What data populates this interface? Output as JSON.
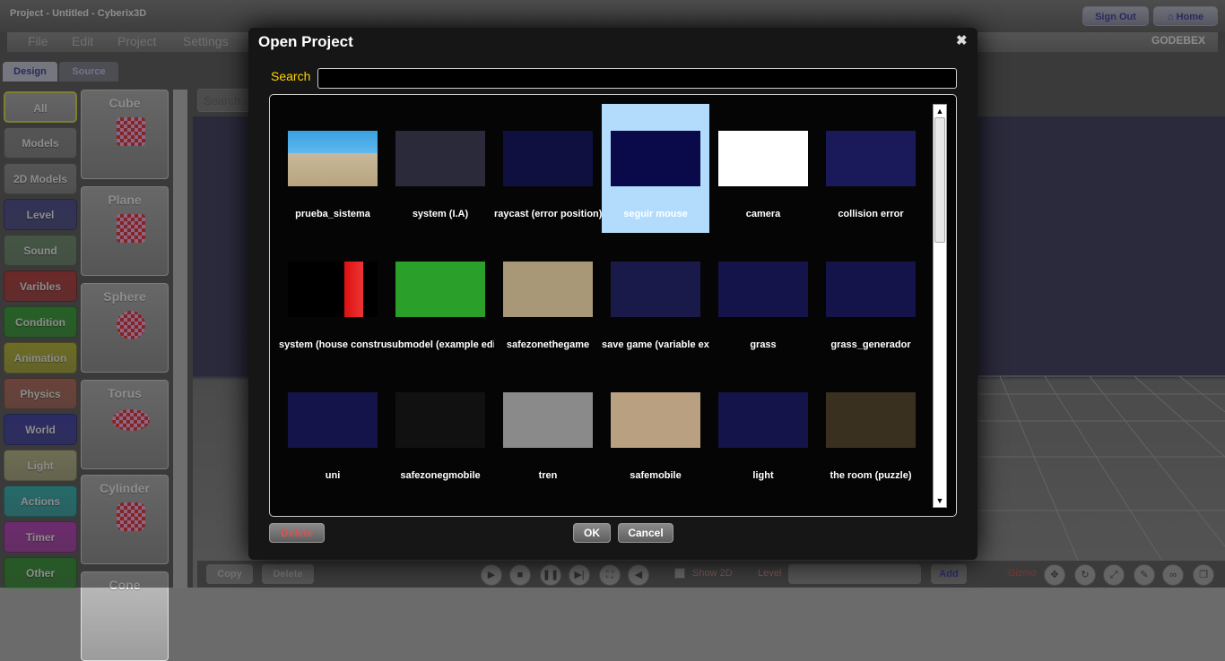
{
  "window": {
    "title": "Project - Untitled - Cyberix3D",
    "signout": "Sign Out",
    "home": "Home"
  },
  "menu": {
    "items": [
      "File",
      "Edit",
      "Project",
      "Settings"
    ],
    "brand": "GODEBEX"
  },
  "tabs": {
    "design": "Design",
    "source": "Source"
  },
  "categories": [
    {
      "label": "All",
      "color": "#b9b9b9"
    },
    {
      "label": "Models",
      "color": "#9c9c9c"
    },
    {
      "label": "2D Models",
      "color": "#9c9c9c"
    },
    {
      "label": "Level",
      "color": "#5b5b9e"
    },
    {
      "label": "Sound",
      "color": "#7f9d7f"
    },
    {
      "label": "Varibles",
      "color": "#c24b4b"
    },
    {
      "label": "Condition",
      "color": "#46b046"
    },
    {
      "label": "Animation",
      "color": "#c6c646"
    },
    {
      "label": "Physics",
      "color": "#c07a6a"
    },
    {
      "label": "World",
      "color": "#5050b8"
    },
    {
      "label": "Light",
      "color": "#c8c89a"
    },
    {
      "label": "Actions",
      "color": "#46c2c2"
    },
    {
      "label": "Timer",
      "color": "#c650c6"
    },
    {
      "label": "Other",
      "color": "#46a446"
    }
  ],
  "objects": [
    "Cube",
    "Plane",
    "Sphere",
    "Torus",
    "Cylinder",
    "Cone"
  ],
  "search": {
    "placeholder": "Search..."
  },
  "bottombar": {
    "copy": "Copy",
    "delete": "Delete",
    "show2d": "Show 2D",
    "level": "Level",
    "add": "Add",
    "gizmo": "Gizmo"
  },
  "dialog": {
    "title": "Open Project",
    "close": "✖",
    "search_label": "Search",
    "projects": [
      {
        "name": "prueba_sistema",
        "selected": false
      },
      {
        "name": "system (I.A)",
        "selected": false
      },
      {
        "name": "raycast (error position)",
        "selected": false
      },
      {
        "name": "seguir mouse",
        "selected": true
      },
      {
        "name": "camera",
        "selected": false
      },
      {
        "name": "collision error",
        "selected": false
      },
      {
        "name": "system (house construction)",
        "selected": false
      },
      {
        "name": "submodel (example editor)",
        "selected": false
      },
      {
        "name": "safezonethegame",
        "selected": false
      },
      {
        "name": "save game (variable example)",
        "selected": false
      },
      {
        "name": "grass",
        "selected": false
      },
      {
        "name": "grass_generador",
        "selected": false
      },
      {
        "name": "uni",
        "selected": false
      },
      {
        "name": "safezonegmobile",
        "selected": false
      },
      {
        "name": "tren",
        "selected": false
      },
      {
        "name": "safemobile",
        "selected": false
      },
      {
        "name": "light",
        "selected": false
      },
      {
        "name": "the room (puzzle)",
        "selected": false
      }
    ],
    "delete_label": "Delete",
    "ok_label": "OK",
    "cancel_label": "Cancel"
  }
}
